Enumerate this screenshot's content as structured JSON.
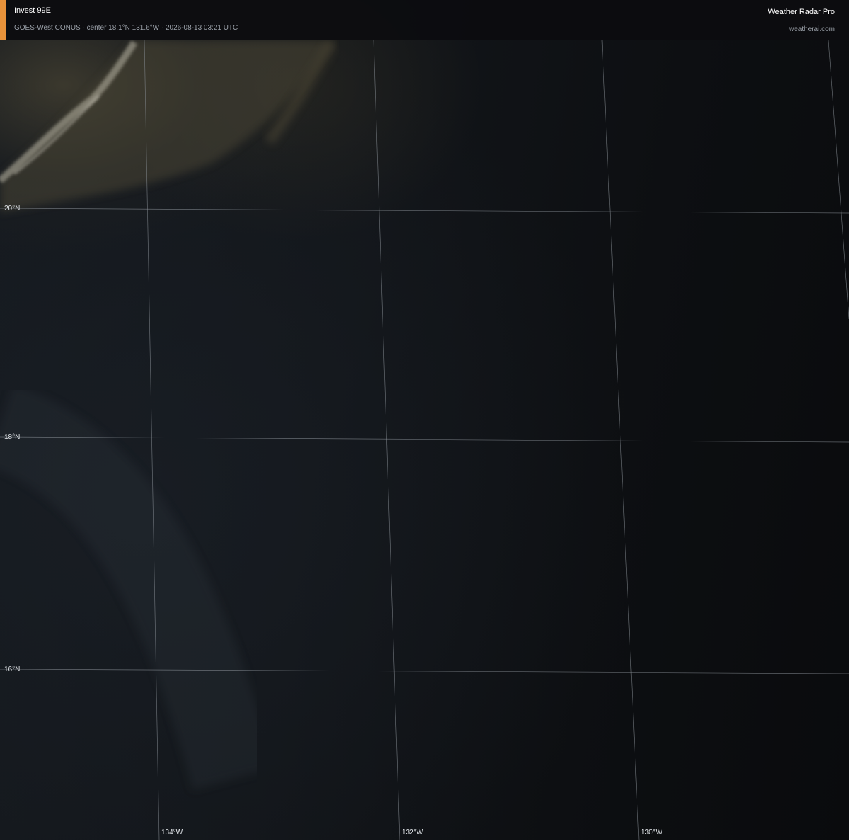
{
  "header": {
    "storm_name": "Invest 99E",
    "subtitle": "GOES-West CONUS · center 18.1°N 131.6°W · 2026-08-13 03:21 UTC",
    "accent_color": "#e8923a",
    "brand_name": "Weather Radar Pro",
    "brand_url": "weatherai.com"
  },
  "map": {
    "latitude_labels": [
      "20°N",
      "18°N",
      "16°N"
    ],
    "longitude_labels": [
      "134°W",
      "132°W",
      "130°W"
    ],
    "grid_color": "#8a9097"
  }
}
